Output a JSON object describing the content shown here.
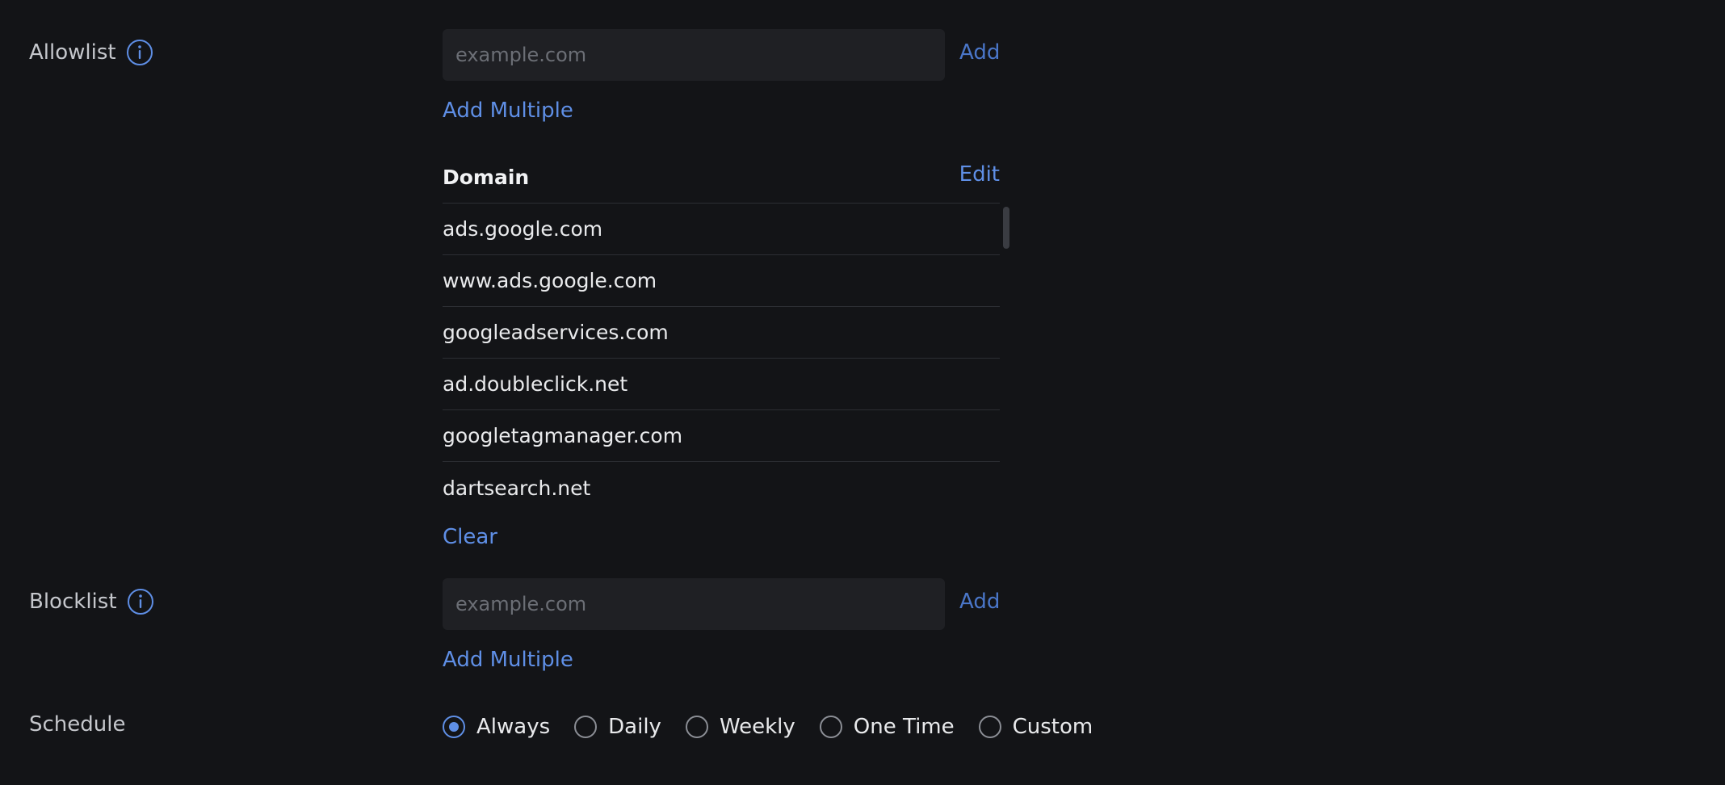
{
  "allowlist": {
    "label": "Allowlist",
    "input_placeholder": "example.com",
    "add_label": "Add",
    "add_multiple_label": "Add Multiple",
    "table": {
      "column_header": "Domain",
      "edit_label": "Edit",
      "rows": [
        "ads.google.com",
        "www.ads.google.com",
        "googleadservices.com",
        "ad.doubleclick.net",
        "googletagmanager.com",
        "dartsearch.net"
      ]
    },
    "clear_label": "Clear"
  },
  "blocklist": {
    "label": "Blocklist",
    "input_placeholder": "example.com",
    "add_label": "Add",
    "add_multiple_label": "Add Multiple"
  },
  "schedule": {
    "label": "Schedule",
    "options": [
      "Always",
      "Daily",
      "Weekly",
      "One Time",
      "Custom"
    ],
    "selected": "Always"
  },
  "colors": {
    "background": "#131417",
    "accent": "#5f8fe6",
    "input_background": "#1f2024"
  }
}
